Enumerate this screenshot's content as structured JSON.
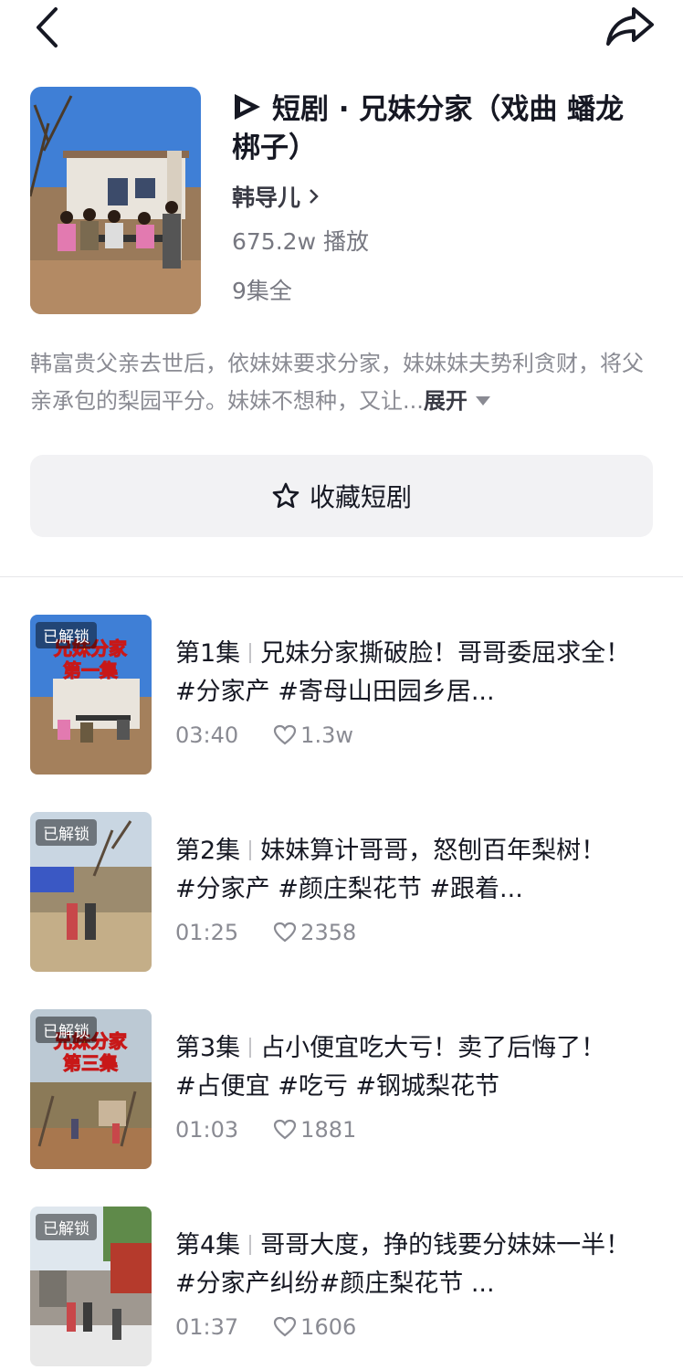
{
  "header": {
    "title": "短剧 · 兄妹分家（戏曲 蟠龙梆子）",
    "author": "韩导儿",
    "plays": "675.2w 播放",
    "episodes_total": "9集全"
  },
  "description": {
    "text": "韩富贵父亲去世后，依妹妹要求分家，妹妹妹夫势利贪财，将父亲承包的梨园平分。妹妹不想种，又让...",
    "expand_label": "展开"
  },
  "collect_button": {
    "label": "收藏短剧"
  },
  "episodes": [
    {
      "badge": "已解锁",
      "num": "第1集",
      "title": "兄妹分家撕破脸！哥哥委屈求全！ #分家产 #寄母山田园乡居...",
      "duration": "03:40",
      "likes": "1.3w",
      "thumb_caption_1": "兄妹分家",
      "thumb_caption_2": "第一集"
    },
    {
      "badge": "已解锁",
      "num": "第2集",
      "title": "妹妹算计哥哥，怒刨百年梨树！ #分家产 #颜庄梨花节 #跟着...",
      "duration": "01:25",
      "likes": "2358"
    },
    {
      "badge": "已解锁",
      "num": "第3集",
      "title": "占小便宜吃大亏！卖了后悔了！ #占便宜 #吃亏 #钢城梨花节",
      "duration": "01:03",
      "likes": "1881",
      "thumb_caption_1": "兄妹分家",
      "thumb_caption_2": "第三集"
    },
    {
      "badge": "已解锁",
      "num": "第4集",
      "title": "哥哥大度，挣的钱要分妹妹一半！ #分家产纠纷#颜庄梨花节 ...",
      "duration": "01:37",
      "likes": "1606"
    }
  ]
}
